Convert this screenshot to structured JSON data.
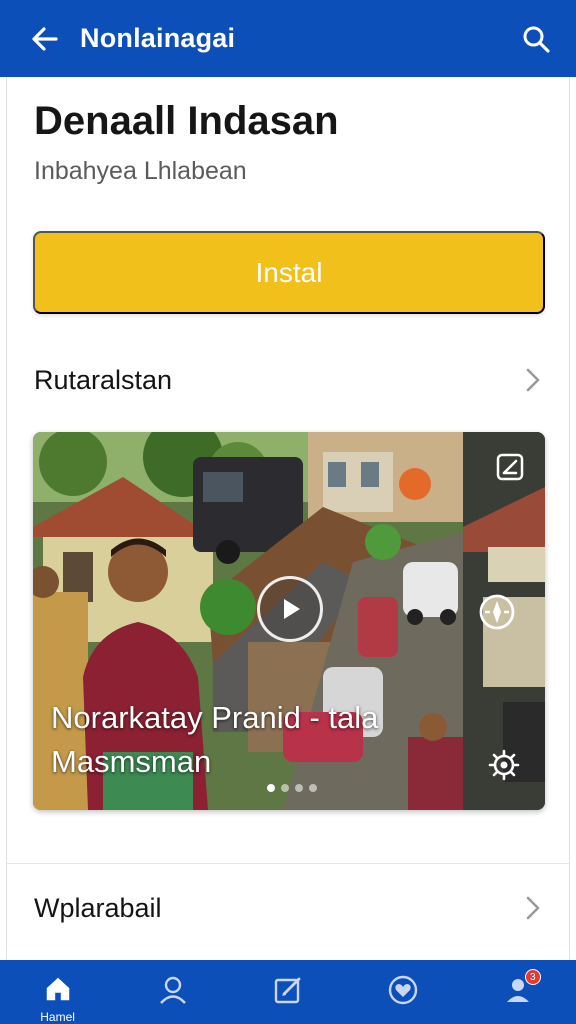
{
  "header": {
    "title": "Nonlainagai",
    "back_icon": "arrow-left-icon",
    "search_icon": "search-icon"
  },
  "app": {
    "name": "Denaall Indasan",
    "subtitle": "Inbahyea Lhlabean",
    "install_label": "Instal"
  },
  "sections": {
    "first_label": "Rutaralstan",
    "second_label": "Wplarabail"
  },
  "media": {
    "caption": "Norarkatay Pranid - tala Masmsman",
    "slide_count": 4,
    "active_slide": 0,
    "side_icons": [
      "edit-icon",
      "compass-icon",
      "settings-icon"
    ]
  },
  "bottom_nav": {
    "items": [
      {
        "name": "home",
        "label": "Hamel",
        "icon": "home-icon"
      },
      {
        "name": "profile",
        "label": "",
        "icon": "person-icon"
      },
      {
        "name": "edit",
        "label": "",
        "icon": "edit-icon"
      },
      {
        "name": "favorites",
        "label": "",
        "icon": "heart-icon"
      },
      {
        "name": "notifications",
        "label": "",
        "icon": "account-icon",
        "badge": "3"
      }
    ]
  },
  "colors": {
    "primary": "#0d4fb8",
    "install_button": "#f2c01b",
    "badge": "#e53935"
  }
}
